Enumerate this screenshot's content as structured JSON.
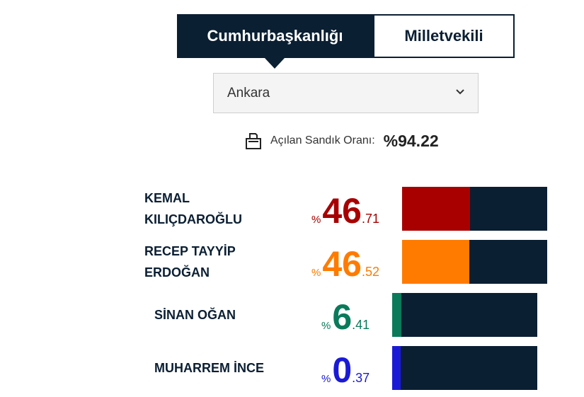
{
  "tabs": [
    {
      "label": "Cumhurbaşkanlığı",
      "active": true
    },
    {
      "label": "Milletvekili",
      "active": false
    }
  ],
  "province_select": {
    "value": "Ankara"
  },
  "ballot_ratio": {
    "label": "Açılan Sandık Oranı:",
    "value": "%94.22",
    "icon": "ballot-box-icon"
  },
  "candidates": [
    {
      "name_line1": "KEMAL",
      "name_line2": "KILIÇDAROĞLU",
      "percent_symbol": "%",
      "int": "46",
      "dec": ".71",
      "value": 46.71,
      "color": "#a80000"
    },
    {
      "name_line1": "RECEP TAYYİP",
      "name_line2": "ERDOĞAN",
      "percent_symbol": "%",
      "int": "46",
      "dec": ".52",
      "value": 46.52,
      "color": "#ff7b00"
    },
    {
      "name_line1": "SİNAN OĞAN",
      "name_line2": "",
      "percent_symbol": "%",
      "int": "6",
      "dec": ".41",
      "value": 6.41,
      "color": "#0a7a5a"
    },
    {
      "name_line1": "MUHARREM İNCE",
      "name_line2": "",
      "percent_symbol": "%",
      "int": "0",
      "dec": ".37",
      "value": 0.37,
      "color": "#1a1ad6"
    }
  ]
}
